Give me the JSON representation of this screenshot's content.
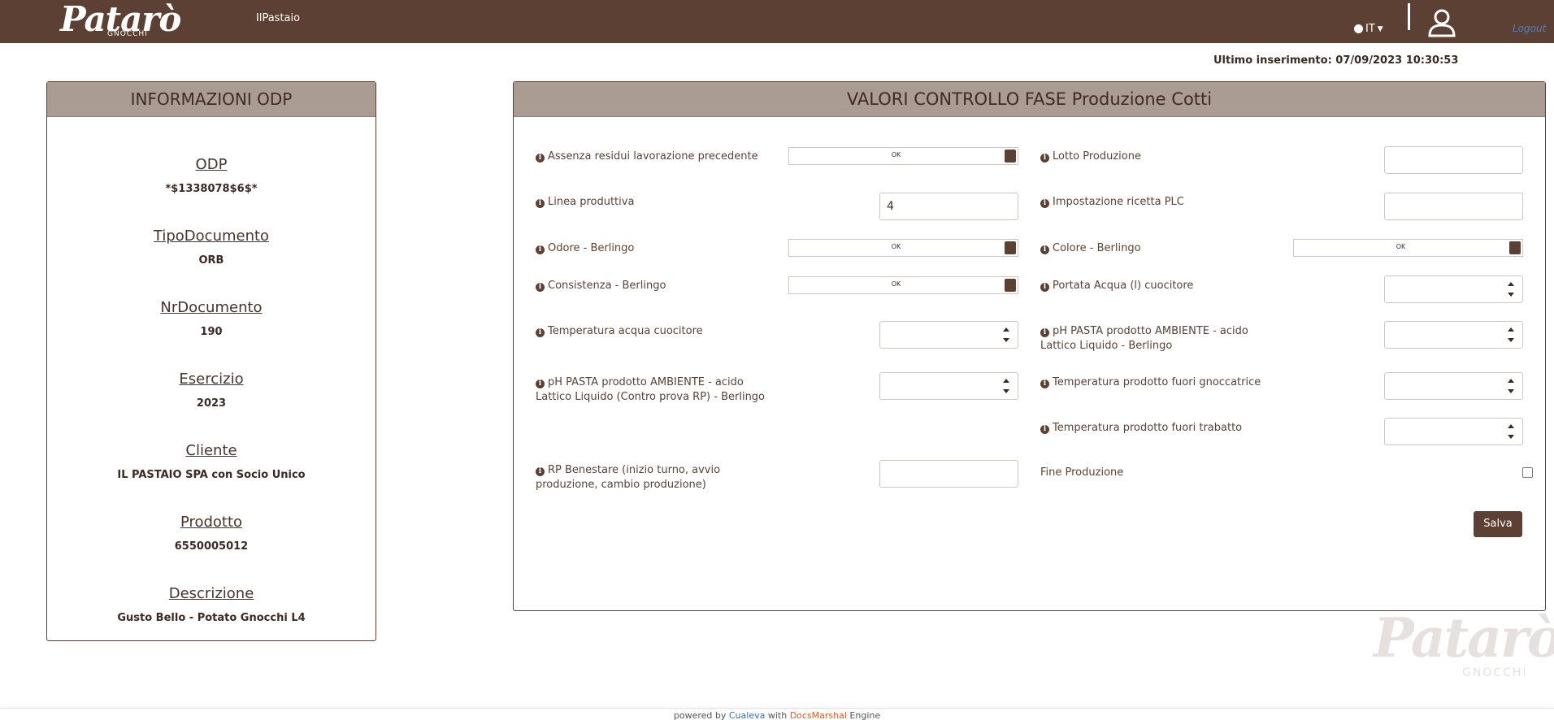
{
  "header": {
    "logo_text": "Patarò",
    "logo_sub": "GNOCCHI",
    "brand_link": "IlPastaio",
    "language": "IT",
    "logout": "Logout"
  },
  "last_insert": "Ultimo inserimento: 07/09/2023 10:30:53",
  "odp_panel": {
    "title": "INFORMAZIONI ODP",
    "items": [
      {
        "label": "ODP",
        "value": "*$1338078$6$*"
      },
      {
        "label": "TipoDocumento",
        "value": "ORB"
      },
      {
        "label": "NrDocumento",
        "value": "190"
      },
      {
        "label": "Esercizio",
        "value": "2023"
      },
      {
        "label": "Cliente",
        "value": "IL PASTAIO SPA con Socio Unico"
      },
      {
        "label": "Prodotto",
        "value": "6550005012"
      },
      {
        "label": "Descrizione",
        "value": "Gusto Bello - Potato Gnocchi L4"
      }
    ]
  },
  "form_panel": {
    "title": "VALORI CONTROLLO FASE Produzione Cotti",
    "fields": {
      "assenza_residui": {
        "label": "Assenza residui lavorazione precedente",
        "value": "OK"
      },
      "linea_produttiva": {
        "label": "Linea produttiva",
        "value": "4"
      },
      "odore": {
        "label": "Odore - Berlingo",
        "value": "OK"
      },
      "consistenza": {
        "label": "Consistenza - Berlingo",
        "value": "OK"
      },
      "temp_acqua": {
        "label": "Temperatura acqua cuocitore",
        "value": ""
      },
      "ph_contro_prova": {
        "label_1": "pH PASTA prodotto AMBIENTE - acido",
        "label_2": "Lattico Liquido (Contro prova RP) - Berlingo",
        "value": ""
      },
      "rp_benestare": {
        "label_1": "RP Benestare (inizio turno, avvio",
        "label_2": "produzione, cambio produzione)",
        "value": ""
      },
      "lotto": {
        "label": "Lotto Produzione",
        "value": ""
      },
      "ricetta_plc": {
        "label": "Impostazione ricetta PLC",
        "value": ""
      },
      "colore": {
        "label": "Colore - Berlingo",
        "value": "OK"
      },
      "portata_acqua": {
        "label": "Portata Acqua (l) cuocitore",
        "value": ""
      },
      "ph_pasta": {
        "label_1": "pH PASTA prodotto AMBIENTE - acido",
        "label_2": "Lattico Liquido - Berlingo",
        "value": ""
      },
      "temp_gnoccatrice": {
        "label": "Temperatura prodotto fuori gnoccatrice",
        "value": ""
      },
      "temp_trabatto": {
        "label": "Temperatura prodotto fuori trabatto",
        "value": ""
      },
      "fine_produzione": {
        "label": "Fine Produzione",
        "checked": false
      }
    },
    "save_label": "Salva"
  },
  "footer": {
    "prefix": "powered by ",
    "company": "Cualeva",
    "middle": " with ",
    "engine": "DocsMarshal",
    "suffix": " Engine"
  },
  "colors": {
    "topbar": "#5c4033",
    "panel_header": "#ab9c93",
    "accent": "#5c4033"
  }
}
